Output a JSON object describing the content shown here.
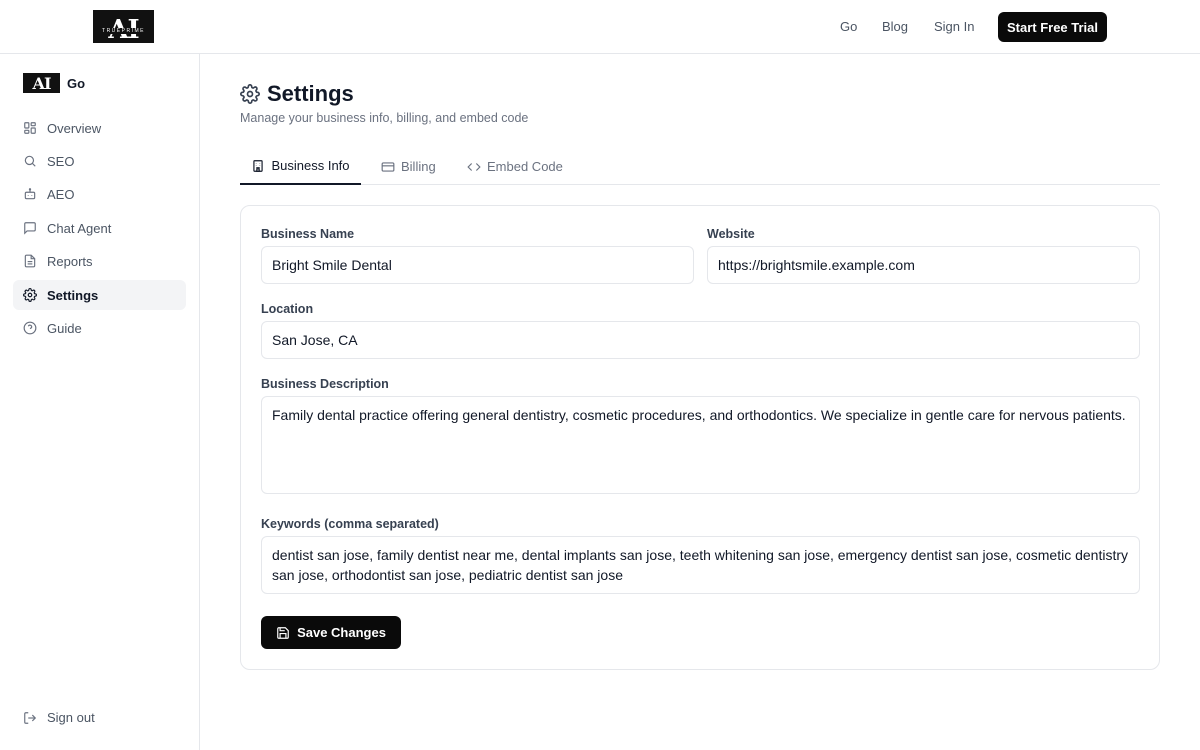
{
  "topnav": {
    "logo_text": "AI",
    "logo_subtext": "TRUEPRIME",
    "links": [
      "Go",
      "Blog",
      "Sign In"
    ],
    "cta_label": "Start Free Trial"
  },
  "sidebar": {
    "brand_name": "Go",
    "items": [
      {
        "label": "Overview",
        "icon": "grid-icon"
      },
      {
        "label": "SEO",
        "icon": "search-icon"
      },
      {
        "label": "AEO",
        "icon": "bot-icon"
      },
      {
        "label": "Chat Agent",
        "icon": "message-icon"
      },
      {
        "label": "Reports",
        "icon": "file-icon"
      },
      {
        "label": "Settings",
        "icon": "gear-icon",
        "active": true
      },
      {
        "label": "Guide",
        "icon": "help-circle-icon"
      }
    ],
    "signout_label": "Sign out"
  },
  "page": {
    "title": "Settings",
    "subtitle": "Manage your business info, billing, and embed code",
    "tabs": [
      {
        "label": "Business Info",
        "icon": "building-icon",
        "active": true
      },
      {
        "label": "Billing",
        "icon": "credit-card-icon"
      },
      {
        "label": "Embed Code",
        "icon": "code-icon"
      }
    ]
  },
  "form": {
    "business_name": {
      "label": "Business Name",
      "value": "Bright Smile Dental"
    },
    "website": {
      "label": "Website",
      "value": "https://brightsmile.example.com"
    },
    "location": {
      "label": "Location",
      "value": "San Jose, CA"
    },
    "description": {
      "label": "Business Description",
      "value": "Family dental practice offering general dentistry, cosmetic procedures, and orthodontics. We specialize in gentle care for nervous patients."
    },
    "keywords": {
      "label": "Keywords (comma separated)",
      "value": "dentist san jose, family dentist near me, dental implants san jose, teeth whitening san jose, emergency dentist san jose, cosmetic dentistry san jose, orthodontist san jose, pediatric dentist san jose"
    },
    "save_label": "Save Changes"
  },
  "colors": {
    "primary": "#0a0a0a",
    "border": "#e5e7eb",
    "active_bg": "#f3f4f6",
    "muted_text": "#6b7280"
  }
}
